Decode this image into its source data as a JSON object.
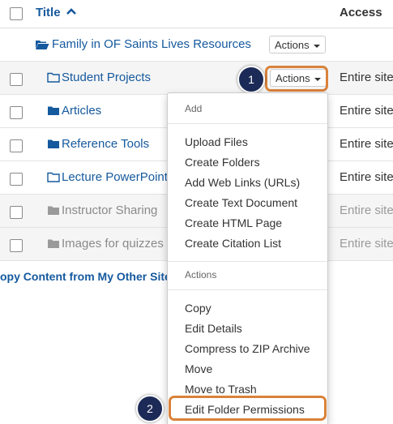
{
  "header": {
    "title_label": "Title",
    "access_label": "Access"
  },
  "parent_row": {
    "label": "Family in OF Saints Lives Resources",
    "actions_label": "Actions"
  },
  "rows": [
    {
      "label": "Student Projects",
      "actions_label": "Actions",
      "access": "Entire site",
      "icon": "folder-outline-icon"
    },
    {
      "label": "Articles",
      "access": "Entire site",
      "icon": "folder-icon"
    },
    {
      "label": "Reference Tools",
      "access": "Entire site",
      "icon": "folder-icon"
    },
    {
      "label": "Lecture PowerPoints",
      "access": "Entire site",
      "icon": "folder-outline-icon"
    },
    {
      "label": "Instructor Sharing",
      "access": "Entire site",
      "icon": "folder-icon"
    },
    {
      "label": "Images for quizzes",
      "access": "Entire site",
      "icon": "folder-icon"
    }
  ],
  "copy_content": "opy Content from My Other Site",
  "menu": {
    "add_header": "Add",
    "add_items": [
      "Upload Files",
      "Create Folders",
      "Add Web Links (URLs)",
      "Create Text Document",
      "Create HTML Page",
      "Create Citation List"
    ],
    "actions_header": "Actions",
    "action_items": [
      "Copy",
      "Edit Details",
      "Compress to ZIP Archive",
      "Move",
      "Move to Trash",
      "Edit Folder Permissions"
    ]
  },
  "badges": [
    "1",
    "2"
  ],
  "colors": {
    "link": "#15599e",
    "highlight": "#d9823b",
    "badge": "#1c2a57"
  }
}
